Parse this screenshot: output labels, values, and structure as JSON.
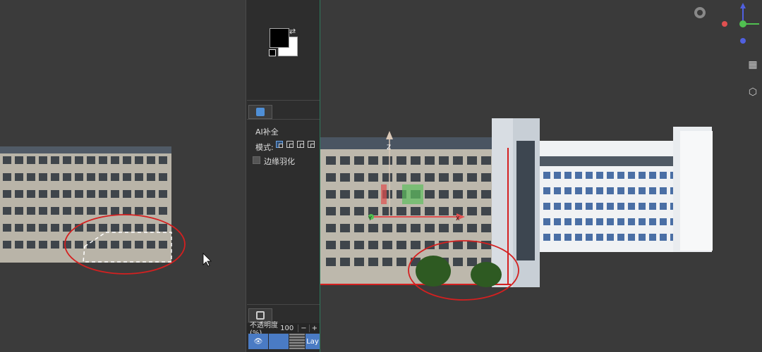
{
  "panel": {
    "ai_fill_title": "AI补全",
    "mode_label": "模式:",
    "feather_label": "边缘羽化",
    "opacity_label": "不透明度(%)",
    "opacity_value": "100",
    "minus": "−",
    "plus": "+",
    "layer_name": "Lay"
  },
  "gizmo": {
    "z_label": "Z",
    "y_label": "Y",
    "x_label": "X"
  },
  "colors": {
    "accent": "#4a7bc4",
    "selection_red": "#d42020",
    "axis_x": "#e05050",
    "axis_y": "#50c050",
    "axis_z": "#5060e0"
  }
}
